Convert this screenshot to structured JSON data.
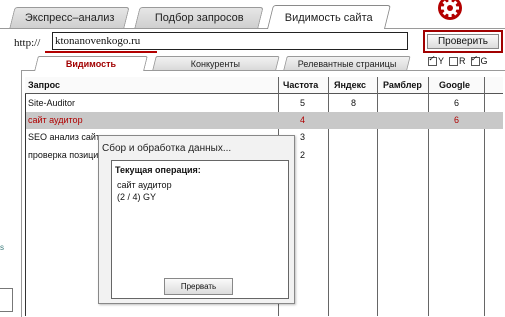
{
  "top_tabs": [
    {
      "label": "Экспресс–анализ",
      "active": false
    },
    {
      "label": "Подбор запросов",
      "active": false
    },
    {
      "label": "Видимость сайта",
      "active": true
    }
  ],
  "settings_icon": "gear-icon",
  "url": {
    "label": "http://",
    "value": "ktonanovenkogo.ru"
  },
  "check_button": "Проверить",
  "sub_tabs": [
    {
      "label": "Видимость",
      "active": true
    },
    {
      "label": "Конкуренты",
      "active": false
    },
    {
      "label": "Релевантные страницы",
      "active": false
    }
  ],
  "engine_checkboxes": [
    {
      "label": "Y",
      "checked": true
    },
    {
      "label": "R",
      "checked": false
    },
    {
      "label": "G",
      "checked": true
    }
  ],
  "table": {
    "headers": [
      "Запрос",
      "Частота",
      "Яндекс",
      "Рамблер",
      "Google"
    ],
    "rows": [
      {
        "query": "Site-Auditor",
        "freq": "5",
        "yandex": "8",
        "rambler": "",
        "google": "6",
        "selected": false
      },
      {
        "query": "сайт аудитор",
        "freq": "4",
        "yandex": "",
        "rambler": "",
        "google": "6",
        "selected": true
      },
      {
        "query": "SEO анализ сайта",
        "freq": "3",
        "yandex": "",
        "rambler": "",
        "google": "",
        "selected": false
      },
      {
        "query": "проверка позиций",
        "freq": "2",
        "yandex": "",
        "rambler": "",
        "google": "",
        "selected": false
      }
    ]
  },
  "dialog": {
    "title": "Сбор и обработка данных...",
    "operation_label": "Текущая операция:",
    "lines": [
      "сайт аудитор",
      "(2 / 4) GY"
    ],
    "abort_button": "Прервать"
  },
  "left_fragment": "s",
  "colors": {
    "accent": "#a10000",
    "selected_row": "#c8c8c8"
  }
}
